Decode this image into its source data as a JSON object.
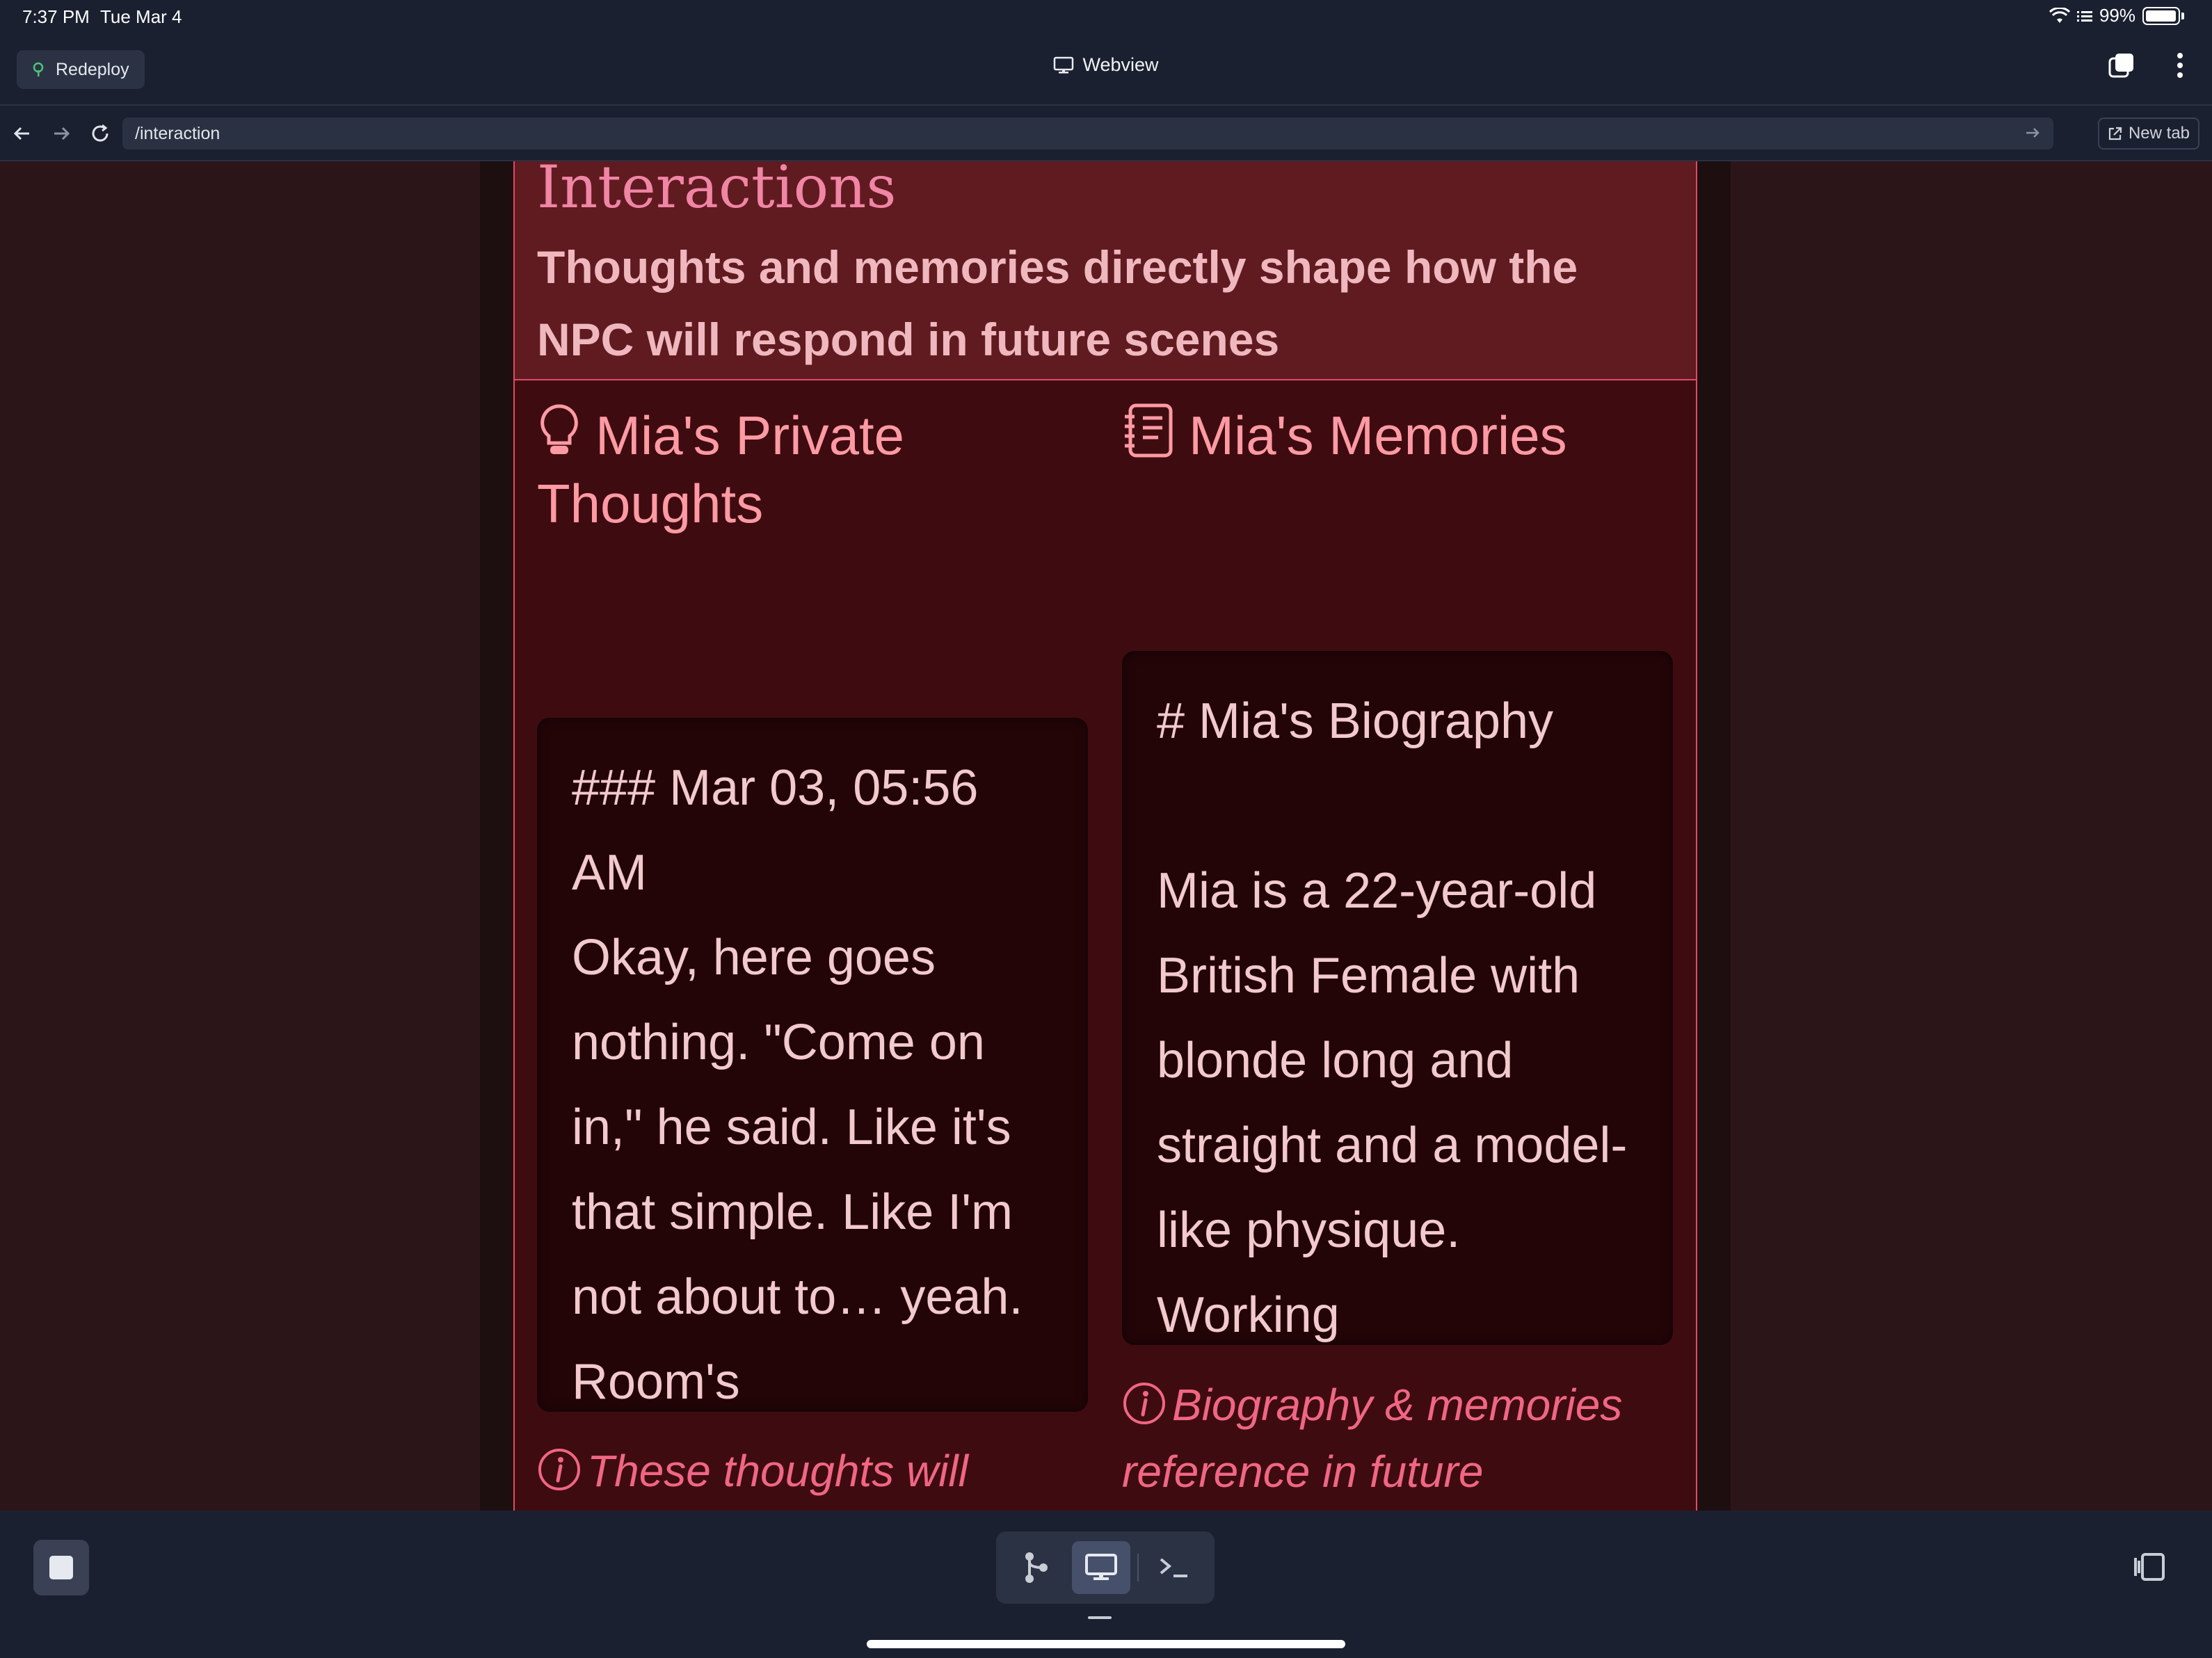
{
  "status_bar": {
    "time": "7:37 PM",
    "date": "Tue Mar 4",
    "battery": "99%"
  },
  "header": {
    "redeploy_label": "Redeploy",
    "title": "Webview"
  },
  "url_bar": {
    "path": "/interaction",
    "new_tab_label": "New tab"
  },
  "page": {
    "title": "Interactions",
    "subtitle": "Thoughts and memories directly shape how the NPC will respond in future scenes",
    "thoughts": {
      "heading": "Mia's Private Thoughts",
      "content": "### Mar 03, 05:56 AM\nOkay, here goes nothing. \"Come on in,\" he said. Like it's that simple. Like I'm not about to… yeah. Room's",
      "note": "These thoughts will guide the NPC's actions in the next scene"
    },
    "memories": {
      "heading": "Mia's Memories",
      "content": "# Mia's Biography\n\nMia is a 22-year-old British Female with blonde long and straight and a model-like physique. Working",
      "note": "Biography & memories reference in future conversations"
    }
  },
  "colors": {
    "accent": "#e04a63",
    "heading": "#ff9aa4",
    "note": "#f06683",
    "panel_bg": "#3e0c10",
    "header_bg": "#601b21"
  },
  "icons": {
    "thoughts": "lightbulb-icon",
    "memories": "notebook-icon",
    "note": "info-circle-icon"
  }
}
